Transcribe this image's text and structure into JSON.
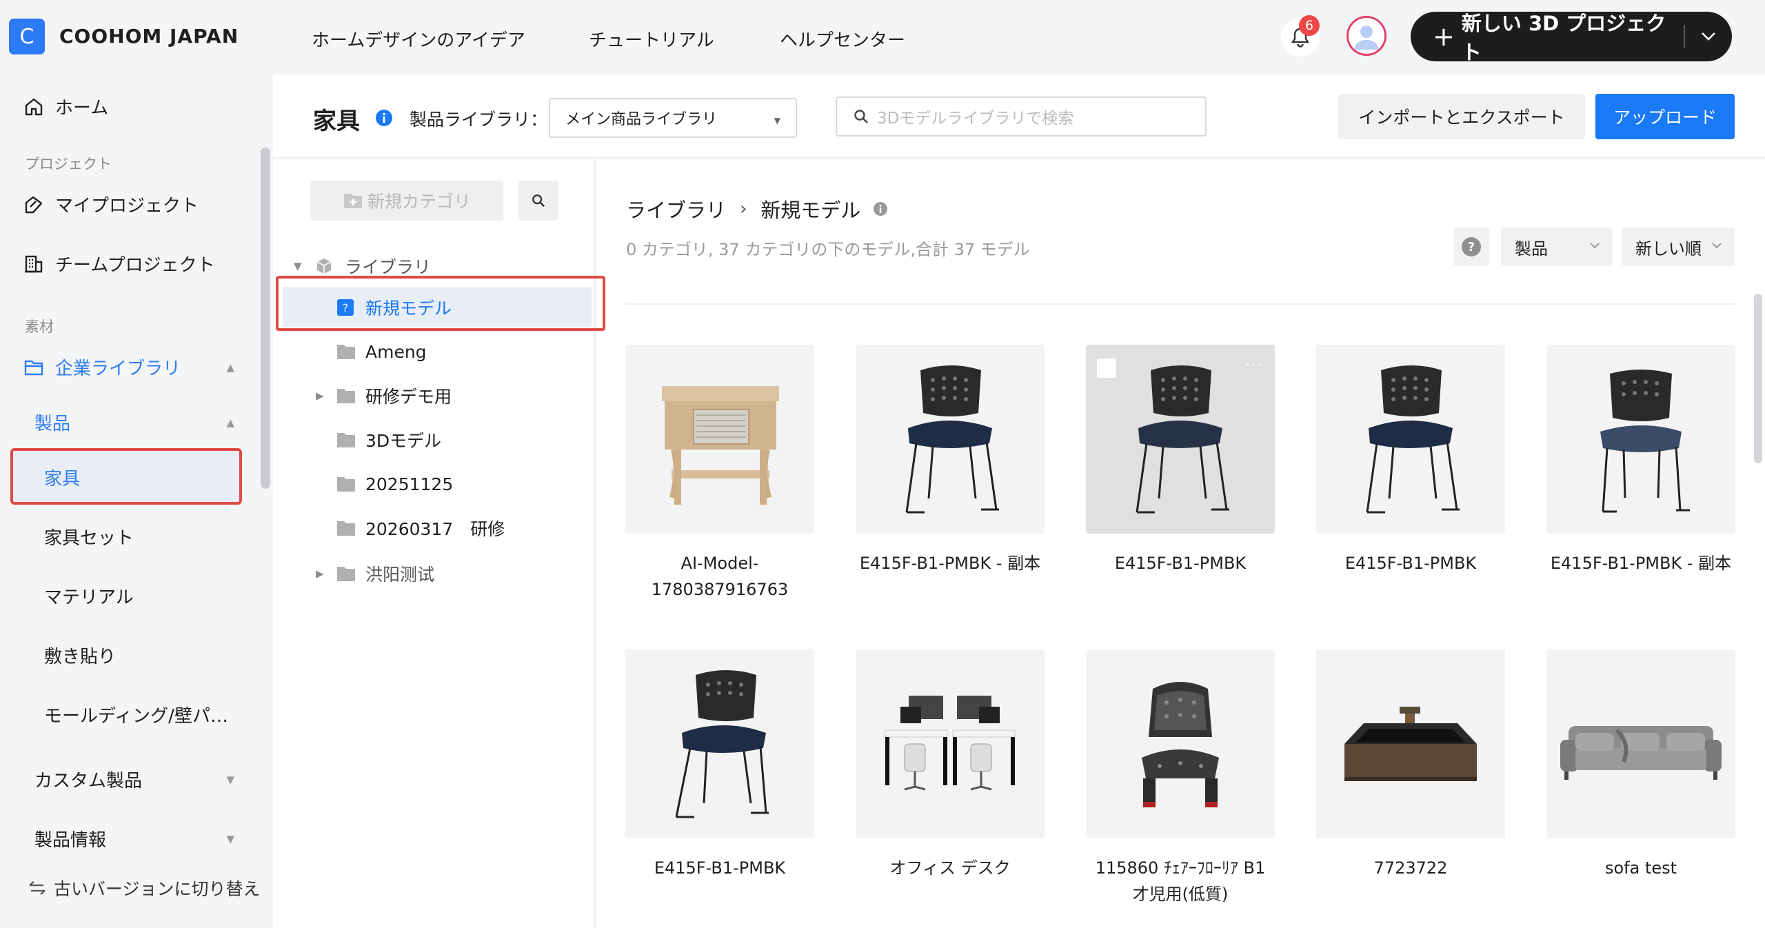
{
  "topbar": {
    "logo_letter": "C",
    "brand": "COOHOM JAPAN",
    "nav": [
      "ホームデザインのアイデア",
      "チュートリアル",
      "ヘルプセンター"
    ],
    "notification_count": "6",
    "new_project_label": "新しい 3D プロジェクト"
  },
  "sidebar": {
    "home": "ホーム",
    "section_projects": "プロジェクト",
    "my_projects": "マイプロジェクト",
    "team_projects": "チームプロジェクト",
    "section_materials": "素材",
    "enterprise_library": "企業ライブラリ",
    "products": "製品",
    "furniture": "家具",
    "furniture_set": "家具セット",
    "material": "マテリアル",
    "tiling": "敷き貼り",
    "molding": "モールディング/壁パ…",
    "custom_products": "カスタム製品",
    "product_info": "製品情報",
    "switch_old": "古いバージョンに切り替え"
  },
  "header": {
    "title": "家具",
    "library_label": "製品ライブラリ：",
    "library_value": "メイン商品ライブラリ",
    "search_placeholder": "3Dモデルライブラリで検索",
    "import_export": "インポートとエクスポート",
    "upload": "アップロード"
  },
  "tree": {
    "new_category": "新規カテゴリ",
    "root": "ライブラリ",
    "items": [
      "新規モデル",
      "Ameng",
      "研修デモ用",
      "3Dモデル",
      "20251125",
      "20260317　研修",
      "洪阳测试"
    ]
  },
  "main": {
    "crumb_root": "ライブラリ",
    "crumb_current": "新規モデル",
    "stats": "0 カテゴリ, 37 カテゴリの下のモデル,合計 37 モデル",
    "filter_type": "製品",
    "sort": "新しい順",
    "models": [
      {
        "name": "AI-Model-\n1780387916763",
        "icon": "nightstand"
      },
      {
        "name": "E415F-B1-PMBK - 副本",
        "icon": "chair"
      },
      {
        "name": "E415F-B1-PMBK",
        "icon": "chair"
      },
      {
        "name": "E415F-B1-PMBK",
        "icon": "chair"
      },
      {
        "name": "E415F-B1-PMBK - 副本",
        "icon": "chair"
      },
      {
        "name": "E415F-B1-PMBK",
        "icon": "chair"
      },
      {
        "name": "オフィス デスク",
        "icon": "office-desk"
      },
      {
        "name": "115860 ﾁｪｱｰﾌﾛｰﾘｱ B1\n才児用(低質)",
        "icon": "kids-chair"
      },
      {
        "name": "7723722",
        "icon": "sink"
      },
      {
        "name": "sofa test",
        "icon": "sofa"
      }
    ]
  },
  "colors": {
    "accent": "#1a7af8",
    "selection_outline": "#e04b43",
    "sidebar_bg": "#f4f5f7"
  }
}
